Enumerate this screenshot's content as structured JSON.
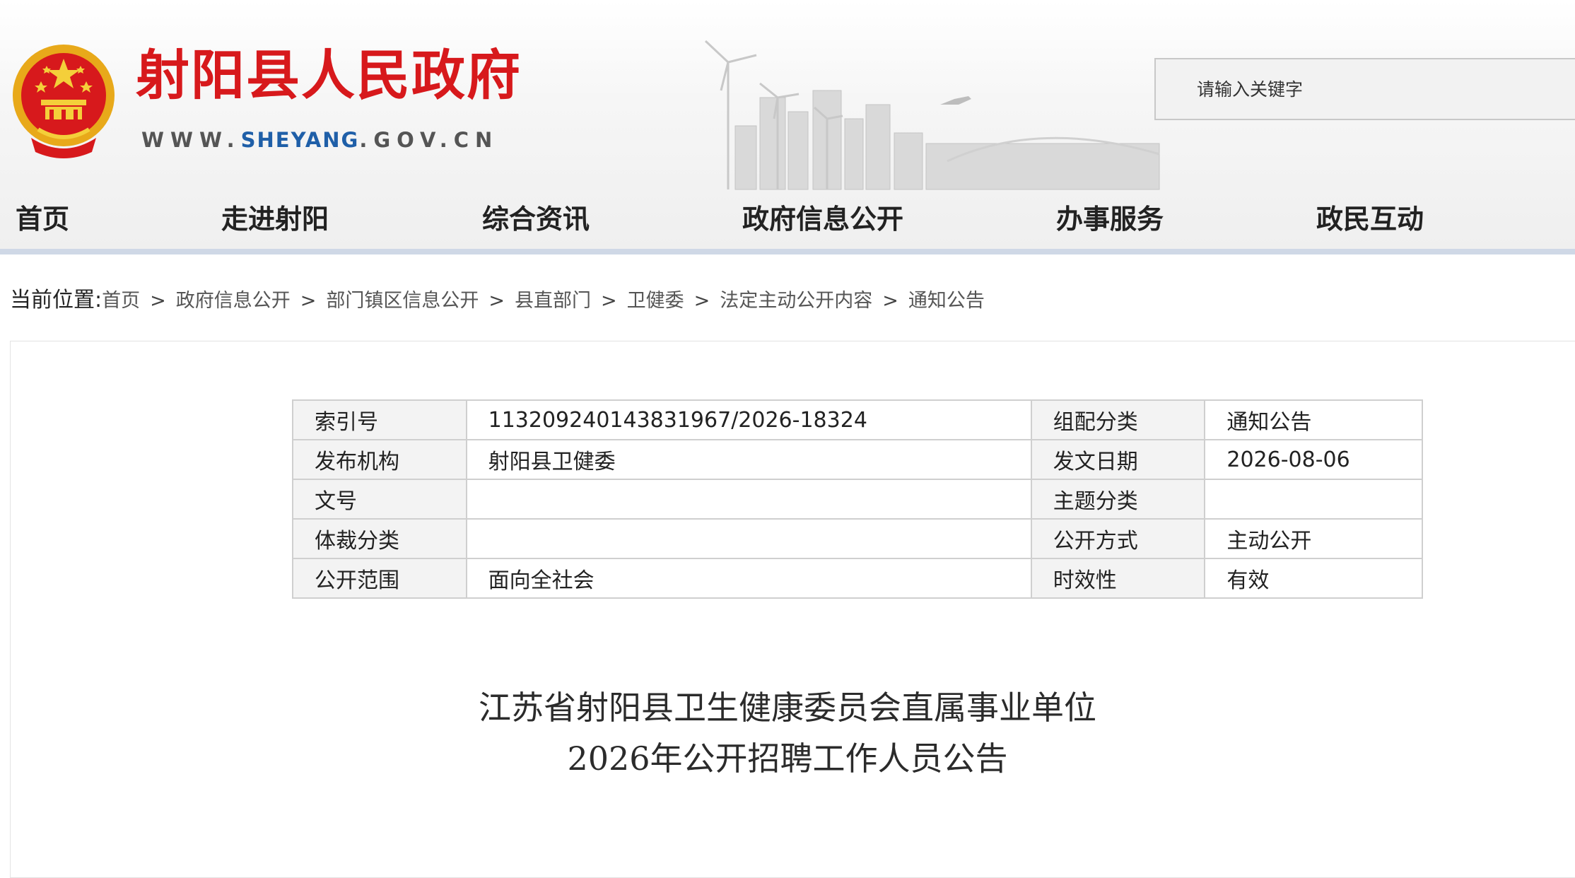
{
  "header": {
    "site_title": "射阳县人民政府",
    "site_url_prefix": "WWW.",
    "site_url_domain": "SHEYANG",
    "site_url_suffix": ".GOV.CN",
    "search_placeholder": "请输入关键字",
    "emblem_icon": "national-emblem-icon",
    "brand_color": "#d7191c"
  },
  "nav": {
    "items": [
      {
        "label": "首页"
      },
      {
        "label": "走进射阳"
      },
      {
        "label": "综合资讯"
      },
      {
        "label": "政府信息公开"
      },
      {
        "label": "办事服务"
      },
      {
        "label": "政民互动"
      }
    ]
  },
  "breadcrumb": {
    "prefix": "当前位置:",
    "items": [
      "首页",
      "政府信息公开",
      "部门镇区信息公开",
      "县直部门",
      "卫健委",
      "法定主动公开内容",
      "通知公告"
    ],
    "separator": ">"
  },
  "meta_table": {
    "rows": [
      {
        "k1": "索引号",
        "v1": "113209240143831967/2026-18324",
        "k2": "组配分类",
        "v2": "通知公告"
      },
      {
        "k1": "发布机构",
        "v1": "射阳县卫健委",
        "k2": "发文日期",
        "v2": "2026-08-06"
      },
      {
        "k1": "文号",
        "v1": "",
        "k2": "主题分类",
        "v2": ""
      },
      {
        "k1": "体裁分类",
        "v1": "",
        "k2": "公开方式",
        "v2": "主动公开"
      },
      {
        "k1": "公开范围",
        "v1": "面向全社会",
        "k2": "时效性",
        "v2": "有效"
      }
    ]
  },
  "document": {
    "title_line1": "江苏省射阳县卫生健康委员会直属事业单位",
    "title_line2": "2026年公开招聘工作人员公告"
  }
}
